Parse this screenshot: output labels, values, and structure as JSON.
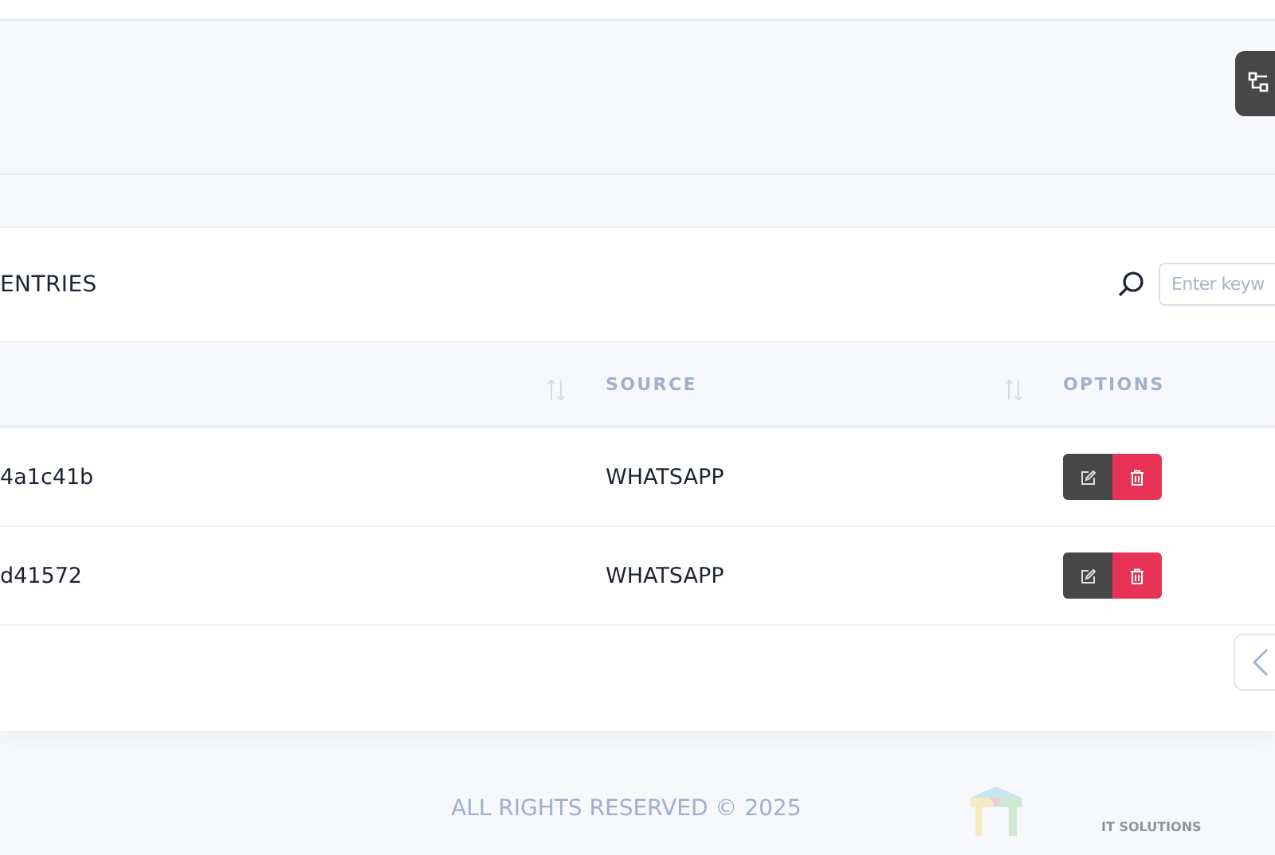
{
  "card": {
    "title": "ENTRIES",
    "search": {
      "placeholder": "Enter keyw"
    }
  },
  "table": {
    "columns": [
      {
        "sortable": true
      },
      {
        "label": "SOURCE",
        "sortable": true
      },
      {
        "label": "OPTIONS",
        "sortable": false
      }
    ],
    "rows": [
      {
        "id": "4a1c41b",
        "source": "WHATSAPP"
      },
      {
        "id": "d41572",
        "source": "WHATSAPP"
      }
    ]
  },
  "footer": {
    "copyright": "ALL RIGHTS RESERVED © 2025",
    "brand_tagline": "IT SOLUTIONS"
  }
}
